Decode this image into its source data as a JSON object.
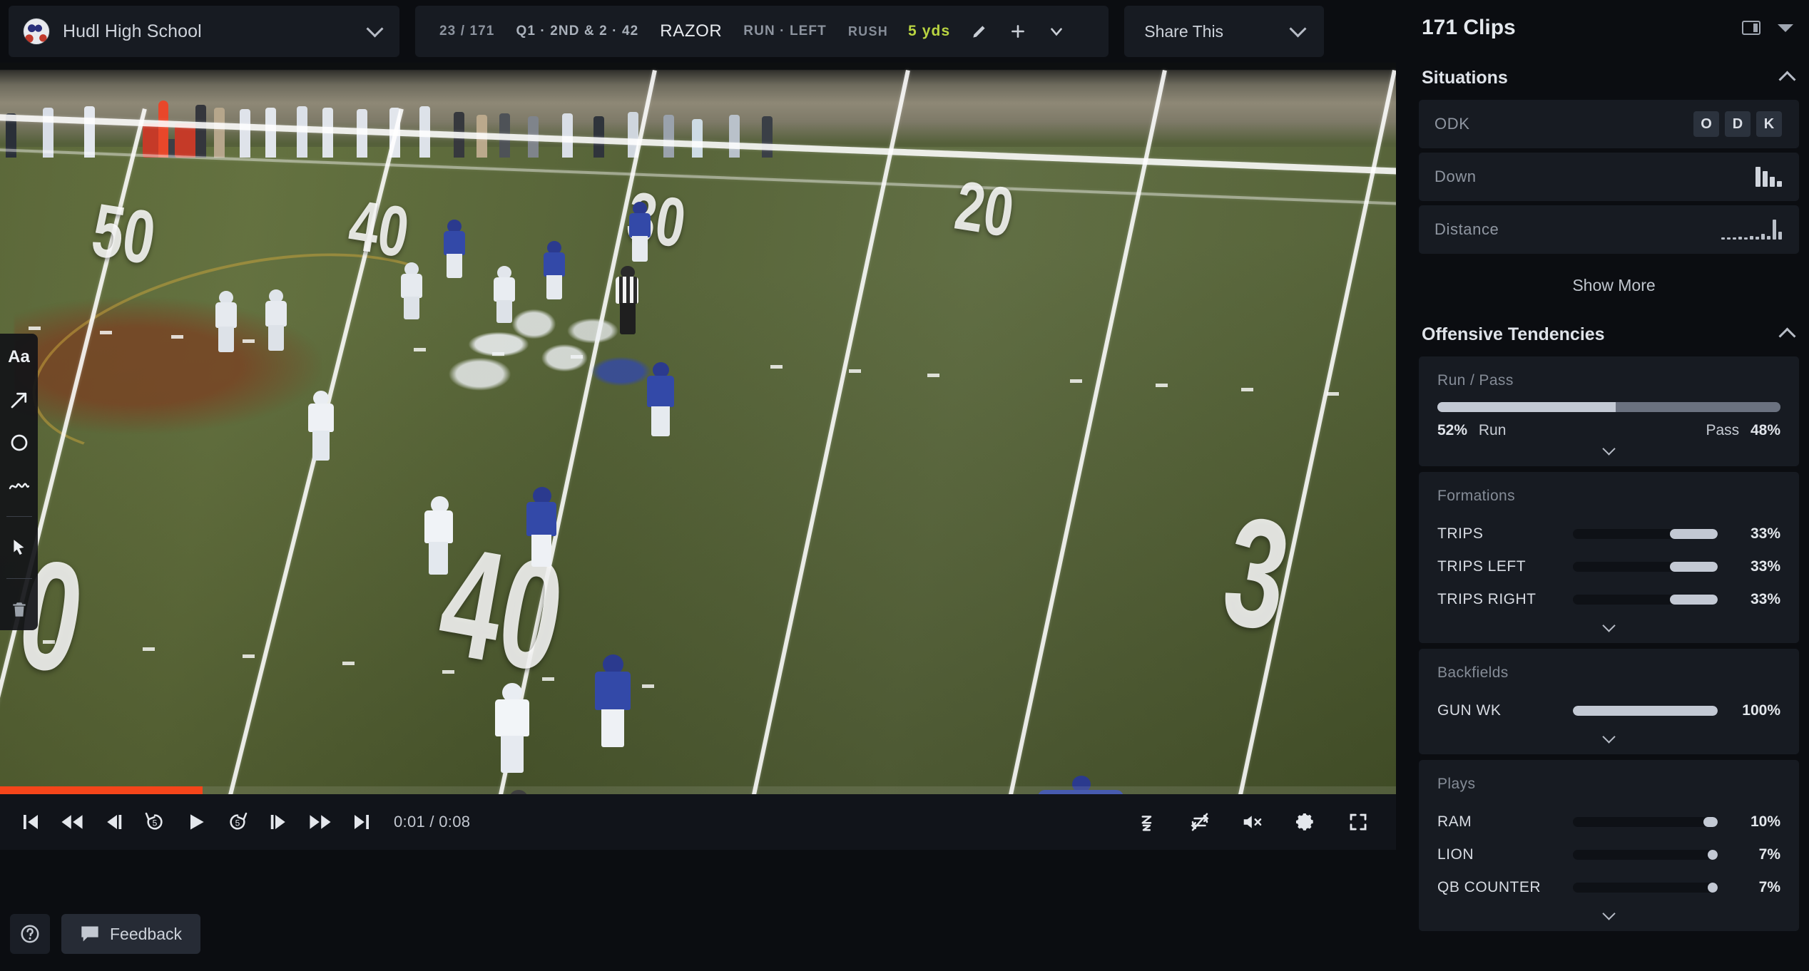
{
  "topbar": {
    "team": {
      "name": "Hudl High School",
      "avatar_icon": "player-avatar",
      "caret_icon": "chevron-down-icon"
    },
    "clip_meta": {
      "index": "23 / 171",
      "situation": "Q1 · 2ND & 2 · 42",
      "play_name": "RAZOR",
      "play_detail": "RUN · LEFT"
    },
    "result": {
      "type_label": "RUSH",
      "yards": "5 yds",
      "yards_color": "#b9d441",
      "edit_icon": "pencil-icon",
      "add_icon": "plus-icon",
      "more_icon": "chevron-down-icon"
    },
    "share": {
      "label": "Share This",
      "caret_icon": "chevron-down-icon"
    }
  },
  "drawing_tools": [
    {
      "name": "text-tool",
      "icon": "text-Aa-icon",
      "label": "Aa"
    },
    {
      "name": "arrow-tool",
      "icon": "arrow-icon",
      "label": ""
    },
    {
      "name": "circle-tool",
      "icon": "circle-icon",
      "label": ""
    },
    {
      "name": "freehand-tool",
      "icon": "squiggle-icon",
      "label": ""
    },
    {
      "name": "select-tool",
      "icon": "cursor-icon",
      "label": ""
    },
    {
      "name": "delete-tool",
      "icon": "trash-icon",
      "label": ""
    }
  ],
  "player": {
    "progress_percent": 14.5,
    "progress_color": "#f5451a",
    "timecode": "0:01 / 0:08",
    "left_controls": [
      {
        "name": "first-clip-button",
        "icon": "skip-to-start-icon"
      },
      {
        "name": "rewind-button",
        "icon": "rewind-icon"
      },
      {
        "name": "previous-frame-button",
        "icon": "step-back-icon"
      },
      {
        "name": "back-5-seconds-button",
        "icon": "replay-5-icon",
        "label": "5"
      },
      {
        "name": "play-button",
        "icon": "play-icon"
      },
      {
        "name": "forward-5-seconds-button",
        "icon": "forward-5-icon",
        "label": "5"
      },
      {
        "name": "next-frame-button",
        "icon": "step-forward-icon"
      },
      {
        "name": "fast-forward-button",
        "icon": "fast-forward-icon"
      },
      {
        "name": "last-clip-button",
        "icon": "skip-to-end-icon"
      }
    ],
    "right_controls": [
      {
        "name": "playback-speed-button",
        "icon": "speed-z-icon"
      },
      {
        "name": "loop-off-button",
        "icon": "loop-disabled-icon"
      },
      {
        "name": "mute-button",
        "icon": "volume-muted-icon"
      },
      {
        "name": "settings-button",
        "icon": "gear-icon"
      },
      {
        "name": "fullscreen-button",
        "icon": "fullscreen-icon"
      }
    ]
  },
  "bottombar": {
    "help": {
      "name": "help-button",
      "icon": "question-mark-icon"
    },
    "feedback": {
      "label": "Feedback",
      "icon": "speech-bubble-icon"
    }
  },
  "sidebar": {
    "header": {
      "title": "171 Clips",
      "panel_icon": "panel-layout-icon",
      "caret_icon": "caret-down-filled-icon"
    },
    "situations": {
      "title": "Situations",
      "collapse_icon": "chevron-up-icon",
      "rows": [
        {
          "label": "ODK",
          "control": "odk-toggle",
          "options": [
            "O",
            "D",
            "K"
          ]
        },
        {
          "label": "Down",
          "control": "bar-chart",
          "bars": [
            26,
            20,
            13,
            7
          ]
        },
        {
          "label": "Distance",
          "control": "bar-chart",
          "bars": [
            2,
            2,
            2,
            3,
            2,
            4,
            3,
            6,
            4,
            22,
            9
          ]
        }
      ],
      "show_more": "Show More"
    },
    "offensive_tendencies": {
      "title": "Offensive Tendencies",
      "collapse_icon": "chevron-up-icon",
      "run_pass": {
        "title": "Run / Pass",
        "run_pct": "52%",
        "run_label": "Run",
        "pass_label": "Pass",
        "pass_pct": "48%",
        "run_value": 52,
        "pass_value": 48,
        "expand_icon": "chevron-down-icon"
      },
      "formations": {
        "title": "Formations",
        "expand_icon": "chevron-down-icon",
        "items": [
          {
            "name": "TRIPS",
            "pct": "33%",
            "value": 33
          },
          {
            "name": "TRIPS LEFT",
            "pct": "33%",
            "value": 33
          },
          {
            "name": "TRIPS RIGHT",
            "pct": "33%",
            "value": 33
          }
        ]
      },
      "backfields": {
        "title": "Backfields",
        "expand_icon": "chevron-down-icon",
        "items": [
          {
            "name": "GUN WK",
            "pct": "100%",
            "value": 100
          }
        ]
      },
      "plays": {
        "title": "Plays",
        "expand_icon": "chevron-down-icon",
        "items": [
          {
            "name": "RAM",
            "pct": "10%",
            "value": 10
          },
          {
            "name": "LION",
            "pct": "7%",
            "value": 7
          },
          {
            "name": "QB COUNTER",
            "pct": "7%",
            "value": 7
          }
        ]
      }
    }
  },
  "colors": {
    "app_bg": "#0b0d11",
    "panel_bg": "#171b22",
    "accent_progress": "#f5451a",
    "accent_yards": "#b9d441",
    "bar_fill": "#c3c9d4",
    "bar_track": "#0e1116"
  }
}
